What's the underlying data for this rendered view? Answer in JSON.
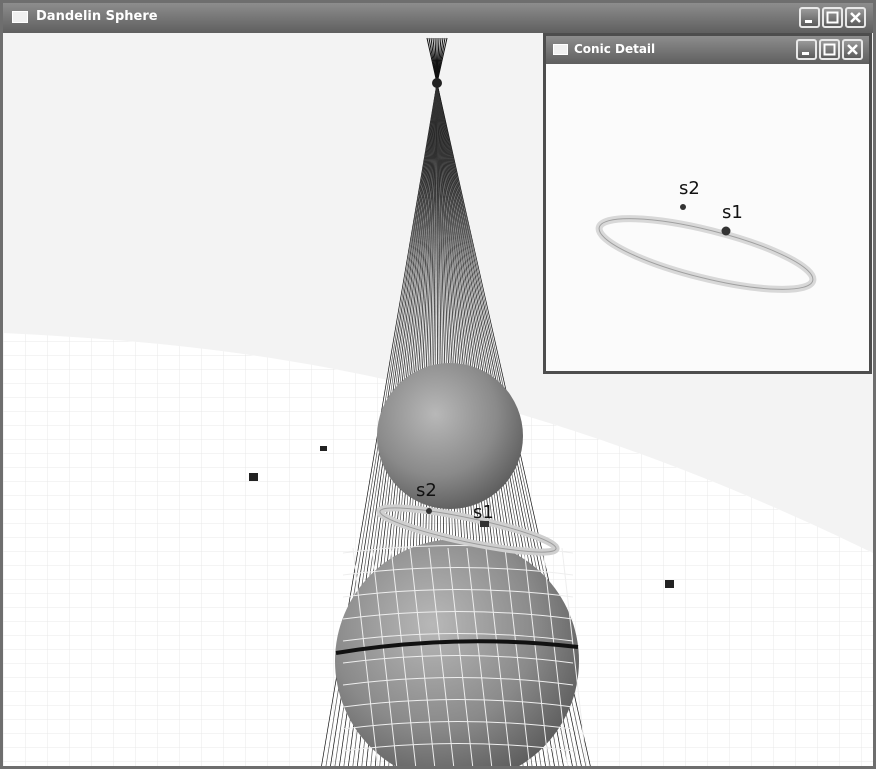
{
  "main_window": {
    "title": "Dandelin Sphere"
  },
  "detail_window": {
    "title": "Conic Detail"
  },
  "scene_labels": {
    "focus_1": "s1",
    "focus_2": "s2"
  },
  "detail_labels": {
    "focus_1": "s1",
    "focus_2": "s2"
  },
  "colors": {
    "titlebar": "#6f6f6f",
    "sphere": "#8a8a8a",
    "ellipse": "#d6d6d6"
  },
  "icons": [
    "window-icon",
    "minimize-icon",
    "maximize-icon",
    "close-icon"
  ]
}
